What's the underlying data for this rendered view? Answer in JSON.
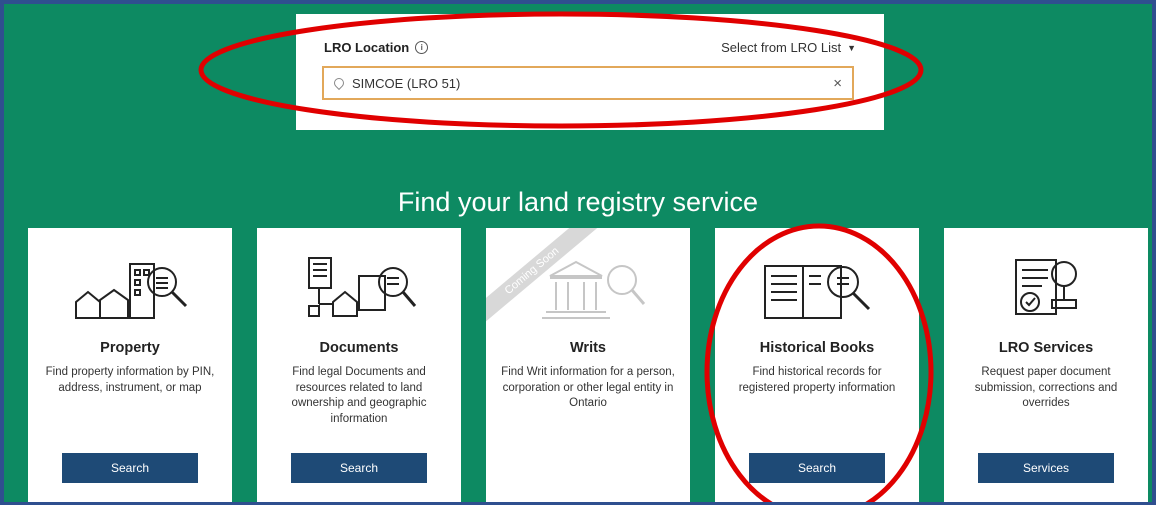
{
  "lro": {
    "label": "LRO Location",
    "select_list": "Select from LRO List",
    "input_value": "SIMCOE (LRO 51)",
    "clear_glyph": "×"
  },
  "heading": "Find your land registry service",
  "cards": [
    {
      "title": "Property",
      "desc": "Find property information by PIN, address, instrument, or map",
      "button": "Search",
      "icon": "property-search-icon"
    },
    {
      "title": "Documents",
      "desc": "Find legal Documents and resources related to land ownership and geographic information",
      "button": "Search",
      "icon": "documents-search-icon"
    },
    {
      "title": "Writs",
      "desc": "Find Writ information for a person, corporation or other legal entity in Ontario",
      "ribbon": "Coming Soon",
      "icon": "courthouse-search-icon"
    },
    {
      "title": "Historical Books",
      "desc": "Find historical records for registered property information",
      "button": "Search",
      "icon": "book-search-icon"
    },
    {
      "title": "LRO Services",
      "desc": "Request paper document submission, corrections and overrides",
      "button": "Services",
      "icon": "document-stamp-icon"
    }
  ],
  "colors": {
    "background": "#0d8a62",
    "button": "#1e4a76",
    "input_border": "#e2a85a",
    "annotation": "#e00000",
    "frame": "#2f4f8f"
  }
}
